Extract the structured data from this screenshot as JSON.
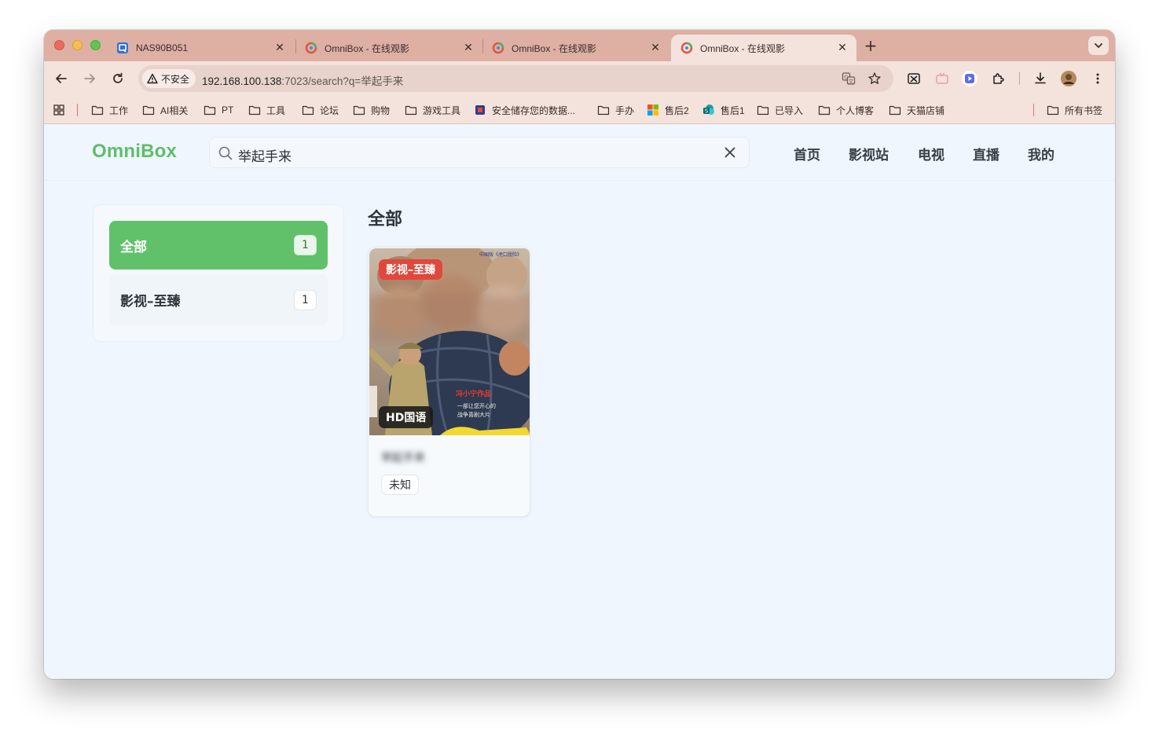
{
  "browser": {
    "tabs": [
      {
        "title": "NAS90B051",
        "favicon": "nas-app-icon",
        "active": false
      },
      {
        "title": "OmniBox - 在线观影",
        "favicon": "omnibox-icon",
        "active": false
      },
      {
        "title": "OmniBox - 在线观影",
        "favicon": "omnibox-icon",
        "active": false
      },
      {
        "title": "OmniBox - 在线观影",
        "favicon": "omnibox-icon",
        "active": true
      }
    ],
    "security_label": "不安全",
    "url_host": "192.168.100.138",
    "url_path": ":7023/search?q=举起手来",
    "bookmarks": [
      {
        "label": "工作",
        "icon": "folder-icon"
      },
      {
        "label": "AI相关",
        "icon": "folder-icon"
      },
      {
        "label": "PT",
        "icon": "folder-icon"
      },
      {
        "label": "工具",
        "icon": "folder-icon"
      },
      {
        "label": "论坛",
        "icon": "folder-icon"
      },
      {
        "label": "购物",
        "icon": "folder-icon"
      },
      {
        "label": "游戏工具",
        "icon": "folder-icon"
      },
      {
        "label": "安全储存您的数据...",
        "icon": "site-favicon"
      },
      {
        "label": "手办",
        "icon": "folder-icon"
      },
      {
        "label": "售后2",
        "icon": "microsoft-icon"
      },
      {
        "label": "售后1",
        "icon": "sharepoint-icon"
      },
      {
        "label": "已导入",
        "icon": "folder-icon"
      },
      {
        "label": "个人博客",
        "icon": "folder-icon"
      },
      {
        "label": "天猫店铺",
        "icon": "folder-icon"
      }
    ],
    "other_bookmarks": "所有书签"
  },
  "site": {
    "logo": "OmniBox",
    "search_value": "举起手来",
    "nav": [
      "首页",
      "影视站",
      "电视",
      "直播",
      "我的"
    ]
  },
  "sidebar": {
    "items": [
      {
        "label": "全部",
        "count": "1",
        "active": true
      },
      {
        "label": "影视–至臻",
        "count": "1",
        "active": false
      }
    ]
  },
  "main": {
    "section_title": "全部",
    "results": [
      {
        "source_badge": "影视–至臻",
        "quality_badge": "HD国语",
        "title": "举起手来",
        "tag": "未知"
      }
    ]
  },
  "colors": {
    "brand_green": "#5fbd6b",
    "source_badge_red": "#e0483d",
    "tab_strip": "#ddb0a3"
  }
}
